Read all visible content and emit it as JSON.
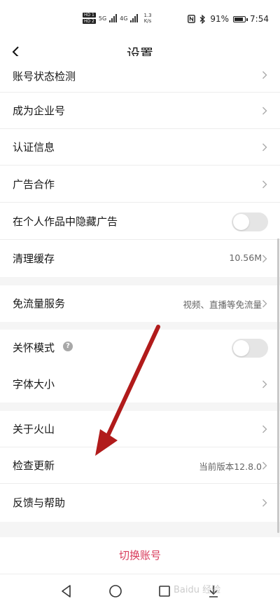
{
  "status_bar": {
    "hd1": "HD 1",
    "hd2": "HD 2",
    "network1": "5G",
    "network2": "4G",
    "speed_value": "1.3",
    "speed_unit": "K/s",
    "battery_percent": "91%",
    "battery_level": 0.91,
    "time": "7:54",
    "icons": [
      "nfc-icon",
      "bluetooth-icon",
      "battery-icon"
    ]
  },
  "header": {
    "title": "设置",
    "back_icon": "chevron-left-icon"
  },
  "groups": [
    {
      "items": [
        {
          "label": "账号状态检测",
          "value": "",
          "control": "chevron"
        },
        {
          "label": "成为企业号",
          "value": "",
          "control": "chevron"
        },
        {
          "label": "认证信息",
          "value": "",
          "control": "chevron"
        },
        {
          "label": "广告合作",
          "value": "",
          "control": "chevron"
        },
        {
          "label": "在个人作品中隐藏广告",
          "value": "",
          "control": "toggle",
          "on": false
        },
        {
          "label": "清理缓存",
          "value": "10.56M",
          "control": "chevron"
        }
      ]
    },
    {
      "items": [
        {
          "label": "免流量服务",
          "value": "视频、直播等免流量",
          "control": "chevron"
        }
      ]
    },
    {
      "items": [
        {
          "label": "关怀模式",
          "value": "",
          "control": "toggle",
          "on": false,
          "help_icon": "?"
        },
        {
          "label": "字体大小",
          "value": "",
          "control": "chevron"
        }
      ]
    },
    {
      "items": [
        {
          "label": "关于火山",
          "value": "",
          "control": "chevron"
        },
        {
          "label": "检查更新",
          "value": "当前版本12.8.0",
          "control": "chevron"
        },
        {
          "label": "反馈与帮助",
          "value": "",
          "control": "chevron"
        }
      ]
    }
  ],
  "switch_account": "切换账号",
  "nav_bar": {
    "icons": [
      "back-triangle-icon",
      "home-circle-icon",
      "recents-square-icon",
      "download-icon"
    ]
  },
  "watermark": "Baidu 经验",
  "colors": {
    "accent": "#d83a5a",
    "arrow": "#b11b1b"
  }
}
